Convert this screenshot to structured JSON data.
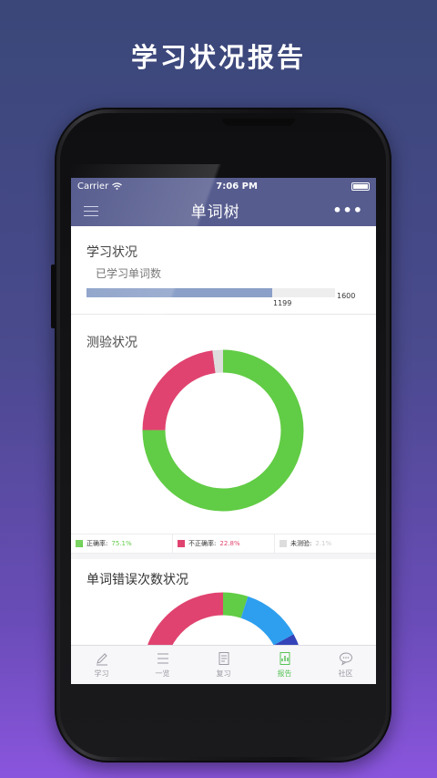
{
  "promo": {
    "title": "学习状况报告"
  },
  "status_bar": {
    "carrier": "Carrier",
    "time": "7:06 PM"
  },
  "nav": {
    "title": "单词树",
    "more": "•••"
  },
  "study": {
    "title": "学习状况",
    "subtitle": "已学习单词数",
    "learned": "1199",
    "total": "1600",
    "progress": 0.749
  },
  "quiz": {
    "title": "测验状况",
    "legend": [
      {
        "label": "正确率:",
        "value": "75.1%",
        "color": "#61cc45"
      },
      {
        "label": "不正确率:",
        "value": "22.8%",
        "color": "#e0436f"
      },
      {
        "label": "未测验:",
        "value": "2.1%",
        "color": "#dddddd"
      }
    ]
  },
  "errors": {
    "title": "单词错误次数状况"
  },
  "chart_data": [
    {
      "type": "pie",
      "title": "测验状况",
      "categories": [
        "正确率",
        "不正确率",
        "未测验"
      ],
      "values": [
        75.1,
        22.8,
        2.1
      ],
      "colors": [
        "#61cc45",
        "#e0436f",
        "#dddddd"
      ]
    },
    {
      "type": "pie",
      "title": "单词错误次数状况",
      "categories": [
        "",
        "",
        "",
        ""
      ],
      "values": [
        5,
        12,
        6,
        77
      ],
      "colors": [
        "#61cc45",
        "#2e9fef",
        "#3443b8",
        "#e0436f"
      ]
    }
  ],
  "tabs": [
    {
      "label": "学习",
      "icon": "pencil-icon",
      "active": false
    },
    {
      "label": "一览",
      "icon": "list-icon",
      "active": false
    },
    {
      "label": "复习",
      "icon": "document-icon",
      "active": false
    },
    {
      "label": "报告",
      "icon": "report-icon",
      "active": true
    },
    {
      "label": "社区",
      "icon": "chat-bubble-icon",
      "active": false
    }
  ]
}
